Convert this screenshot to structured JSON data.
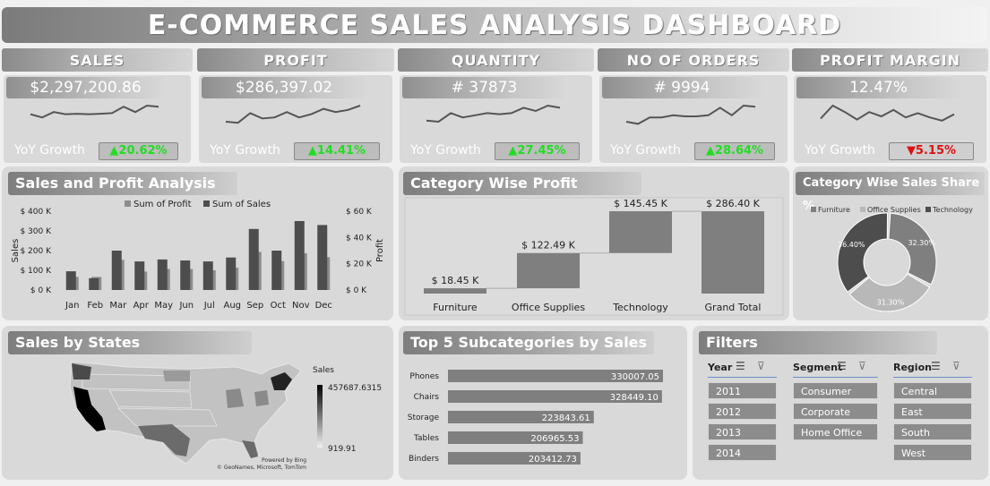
{
  "title": "E-COMMERCE SALES ANALYSIS DASHBOARD",
  "kpis": [
    {
      "label": "SALES",
      "value": "$2,297,200.86",
      "yoy_label": "YoY Growth",
      "yoy": "▲20.62%",
      "yoy_color": "#22dd22",
      "spark": [
        0.4,
        0.55,
        0.3,
        0.4,
        0.38,
        0.4,
        0.38,
        0.35,
        0.05,
        0.3,
        0,
        0.05
      ]
    },
    {
      "label": "PROFIT",
      "value": "$286,397.02",
      "yoy_label": "YoY Growth",
      "yoy": "▲14.41%",
      "yoy_color": "#22dd22",
      "spark": [
        0.75,
        0.8,
        0.35,
        0.6,
        0.55,
        0.3,
        0.55,
        0.4,
        0.15,
        0.3,
        0.2,
        0
      ]
    },
    {
      "label": "QUANTITY",
      "value": "# 37873",
      "yoy_label": "YoY Growth",
      "yoy": "▲27.45%",
      "yoy_color": "#22dd22",
      "spark": [
        0.7,
        0.75,
        0.35,
        0.55,
        0.45,
        0.35,
        0.4,
        0.35,
        0.1,
        0.25,
        0,
        0.1
      ]
    },
    {
      "label": "NO OF ORDERS",
      "value": "# 9994",
      "yoy_label": "YoY Growth",
      "yoy": "▲28.64%",
      "yoy_color": "#22dd22",
      "spark": [
        0.75,
        0.85,
        0.55,
        0.55,
        0.45,
        0.5,
        0.5,
        0.45,
        0.1,
        0.45,
        0,
        0.05
      ]
    },
    {
      "label": "PROFIT MARGIN",
      "value": "12.47%",
      "yoy_label": "YoY Growth",
      "yoy": "▼5.15%",
      "yoy_color": "#e01010",
      "spark": [
        0.6,
        0,
        0.3,
        0.65,
        0.3,
        0.5,
        0.2,
        0.55,
        0.35,
        0.55,
        0.7,
        0.4
      ]
    }
  ],
  "sales_profit": {
    "title": "Sales and Profit Analysis",
    "legend": [
      "Sum of Profit",
      "Sum of Sales"
    ],
    "ylabel_left": "Sales",
    "ylabel_right": "Profit",
    "left_ticks": [
      "$ 400 K",
      "$ 300 K",
      "$ 200 K",
      "$ 100 K",
      "$ 0 K"
    ],
    "right_ticks": [
      "$ 60 K",
      "$ 40 K",
      "$ 20 K",
      "$ 0 K"
    ],
    "months": [
      "Jan",
      "Feb",
      "Mar",
      "Apr",
      "May",
      "Jun",
      "Jul",
      "Aug",
      "Sep",
      "Oct",
      "Nov",
      "Dec"
    ],
    "chart_data": {
      "type": "bar",
      "categories": [
        "Jan",
        "Feb",
        "Mar",
        "Apr",
        "May",
        "Jun",
        "Jul",
        "Aug",
        "Sep",
        "Oct",
        "Nov",
        "Dec"
      ],
      "series": [
        {
          "name": "Sum of Sales",
          "axis": "left",
          "values": [
            95,
            60,
            200,
            145,
            155,
            150,
            145,
            165,
            310,
            200,
            350,
            330
          ]
        },
        {
          "name": "Sum of Profit",
          "axis": "right",
          "values": [
            10,
            10,
            23,
            14,
            16,
            16,
            15,
            17,
            29,
            22,
            28,
            25
          ]
        }
      ],
      "ylim_left": [
        0,
        400
      ],
      "ylim_right": [
        0,
        60
      ]
    }
  },
  "category_profit": {
    "title": "Category Wise Profit",
    "chart_data": {
      "type": "bar",
      "categories": [
        "Furniture",
        "Office Supplies",
        "Technology",
        "Grand Total"
      ],
      "labels": [
        "$ 18.45 K",
        "$ 122.49 K",
        "$ 145.45 K",
        "$ 286.40 K"
      ],
      "values": [
        18.45,
        122.49,
        145.45,
        286.4
      ]
    }
  },
  "category_share": {
    "title": "Category Wise Sales Share %",
    "chart_data": {
      "type": "pie",
      "labels": [
        "Furniture",
        "Office Supplies",
        "Technology"
      ],
      "values": [
        32.3,
        31.3,
        36.4
      ],
      "value_labels": [
        "32.30%",
        "31.30%",
        "36.40%"
      ],
      "colors": [
        "#7f7f7f",
        "#b8b8b8",
        "#4d4d4d"
      ]
    }
  },
  "states": {
    "title": "Sales by States",
    "legend_title": "Sales",
    "max": "457687.6315",
    "min": "919.91",
    "credit1": "Powered by Bing",
    "credit2": "© GeoNames, Microsoft, TomTom"
  },
  "subcategories": {
    "title": "Top 5 Subcategories by Sales",
    "chart_data": {
      "type": "bar",
      "categories": [
        "Phones",
        "Chairs",
        "Storage",
        "Tables",
        "Binders"
      ],
      "values": [
        330007.05,
        328449.1,
        223843.61,
        206965.53,
        203412.73
      ],
      "value_labels": [
        "330007.05",
        "328449.10",
        "223843.61",
        "206965.53",
        "203412.73"
      ]
    }
  },
  "filters": {
    "title": "Filters",
    "year": {
      "label": "Year",
      "items": [
        "2011",
        "2012",
        "2013",
        "2014"
      ]
    },
    "segment": {
      "label": "Segment",
      "items": [
        "Consumer",
        "Corporate",
        "Home Office"
      ]
    },
    "region": {
      "label": "Region",
      "items": [
        "Central",
        "East",
        "South",
        "West"
      ]
    }
  }
}
